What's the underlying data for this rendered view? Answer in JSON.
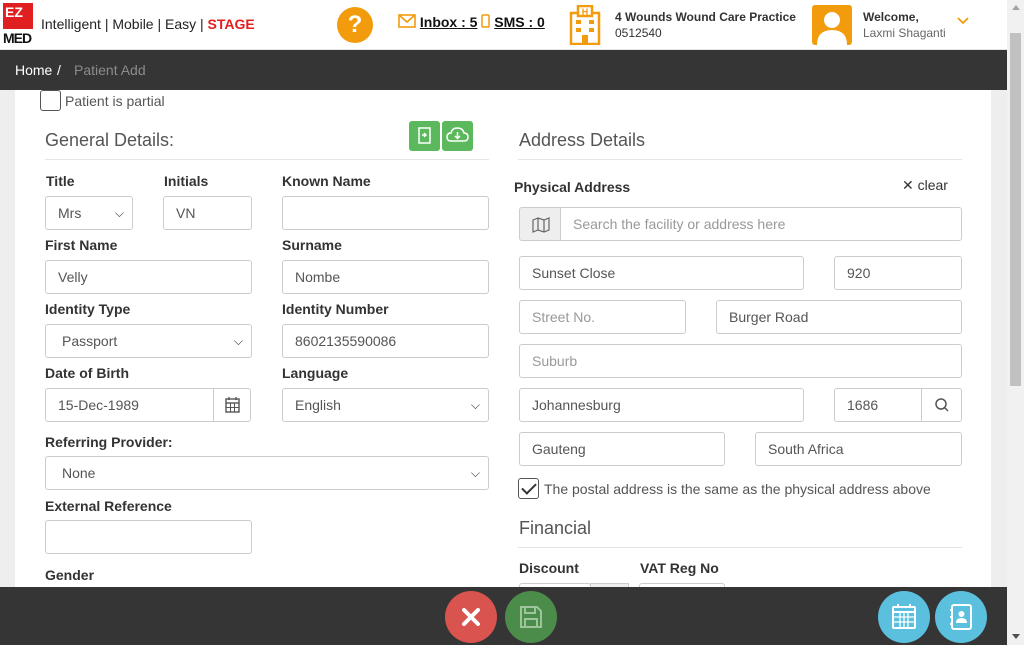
{
  "header": {
    "logo_top": "EZ",
    "logo_bottom": "MED",
    "tagline": "Intelligent | Mobile | Easy | ",
    "stage": "STAGE",
    "help": "?",
    "inbox": "Inbox : 5",
    "sms": "SMS : 0",
    "practice_name": "4 Wounds Wound Care Practice",
    "practice_number": "0512540",
    "welcome": "Welcome,",
    "user": "Laxmi Shaganti"
  },
  "breadcrumb": {
    "home": "Home",
    "sep": "/",
    "current": "Patient Add"
  },
  "form": {
    "partial_label": "Patient is partial",
    "general_title": "General Details:",
    "title_label": "Title",
    "title_value": "Mrs",
    "initials_label": "Initials",
    "initials_value": "VN",
    "known_name_label": "Known Name",
    "known_name_value": "",
    "first_name_label": "First Name",
    "first_name_value": "Velly",
    "surname_label": "Surname",
    "surname_value": "Nombe",
    "identity_type_label": "Identity Type",
    "identity_type_value": "Passport",
    "identity_number_label": "Identity Number",
    "identity_number_value": "8602135590086",
    "dob_label": "Date of Birth",
    "dob_value": "15-Dec-1989",
    "language_label": "Language",
    "language_value": "English",
    "referring_label": "Referring Provider:",
    "referring_value": "None",
    "external_label": "External Reference",
    "external_value": "",
    "gender_label": "Gender"
  },
  "address": {
    "title": "Address Details",
    "physical_label": "Physical Address",
    "clear": "clear",
    "search_placeholder": "Search the facility or address here",
    "complex": "Sunset Close",
    "unit": "920",
    "street_no_placeholder": "Street No.",
    "street": "Burger Road",
    "suburb_placeholder": "Suburb",
    "city": "Johannesburg",
    "postal_code": "1686",
    "province": "Gauteng",
    "country": "South Africa",
    "same_postal_label": "The postal address is the same as the physical address above"
  },
  "financial": {
    "title": "Financial",
    "discount_label": "Discount",
    "vat_label": "VAT Reg No"
  },
  "colors": {
    "brand_red": "#e02020",
    "accent_orange": "#f29b0c",
    "green": "#5cb85c",
    "dark_bar": "#353535",
    "cancel": "#d9534f",
    "save": "#4c8c4a",
    "info": "#5bc0de"
  }
}
